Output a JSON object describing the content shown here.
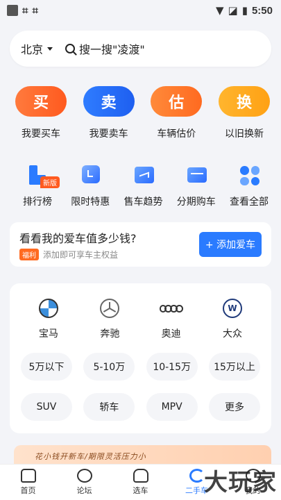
{
  "status_bar": {
    "time": "5:50"
  },
  "search": {
    "city": "北京",
    "placeholder": "搜一搜\"凌渡\""
  },
  "main_actions": [
    {
      "pill": "买",
      "label": "我要买车"
    },
    {
      "pill": "卖",
      "label": "我要卖车"
    },
    {
      "pill": "估",
      "label": "车辆估价"
    },
    {
      "pill": "换",
      "label": "以旧换新"
    }
  ],
  "tools": [
    {
      "label": "排行榜",
      "badge": "新版",
      "icon": "rank-icon"
    },
    {
      "label": "限时特惠",
      "icon": "discount-icon"
    },
    {
      "label": "售车趋势",
      "icon": "trend-icon"
    },
    {
      "label": "分期购车",
      "icon": "installment-icon"
    },
    {
      "label": "查看全部",
      "icon": "grid-icon"
    }
  ],
  "sell_card": {
    "title": "看看我的爱车值多少钱?",
    "tag": "福利",
    "subtitle": "添加即可享车主权益",
    "button": "+ 添加爱车"
  },
  "brands": [
    {
      "label": "宝马",
      "icon": "bmw-logo"
    },
    {
      "label": "奔驰",
      "icon": "benz-logo"
    },
    {
      "label": "奥迪",
      "icon": "audi-logo"
    },
    {
      "label": "大众",
      "icon": "vw-logo"
    }
  ],
  "price_chips": [
    "5万以下",
    "5-10万",
    "10-15万",
    "15万以上"
  ],
  "type_chips": [
    "SUV",
    "轿车",
    "MPV",
    "更多"
  ],
  "promo": {
    "text": "花小钱开新车/期限灵活压力小"
  },
  "tabbar": [
    {
      "label": "首页"
    },
    {
      "label": "论坛"
    },
    {
      "label": "选车"
    },
    {
      "label": "二手车"
    },
    {
      "label": "我的"
    }
  ],
  "watermark": "大玩家"
}
